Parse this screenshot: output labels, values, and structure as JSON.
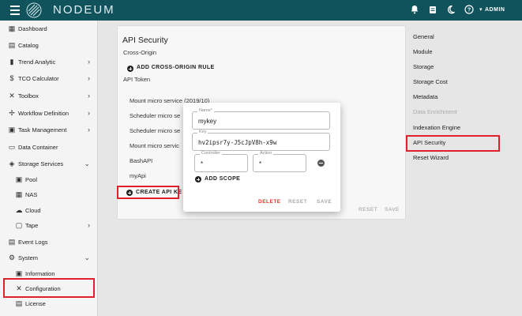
{
  "app": {
    "brand": "NODEUM",
    "user": "ADMIN",
    "notification_badge": "",
    "task_badge": ""
  },
  "sidebar": {
    "items": [
      {
        "label": "Dashboard",
        "icon": "dashboard-icon"
      },
      {
        "label": "Catalog",
        "icon": "catalog-icon"
      },
      {
        "label": "Trend Analytic",
        "icon": "bar-chart-icon",
        "expandable": true
      },
      {
        "label": "TCO Calculator",
        "icon": "dollar-icon",
        "expandable": true
      },
      {
        "label": "Toolbox",
        "icon": "tools-icon",
        "expandable": true
      },
      {
        "label": "Workflow Definition",
        "icon": "workflow-icon",
        "expandable": true
      },
      {
        "label": "Task Management",
        "icon": "calendar-icon",
        "expandable": true
      },
      {
        "label": "Data Container",
        "icon": "container-icon"
      },
      {
        "label": "Storage Services",
        "icon": "layers-icon",
        "expanded": true
      },
      {
        "label": "Pool",
        "icon": "pool-icon"
      },
      {
        "label": "NAS",
        "icon": "nas-icon"
      },
      {
        "label": "Cloud",
        "icon": "cloud-icon"
      },
      {
        "label": "Tape",
        "icon": "tape-icon",
        "expandable": true
      },
      {
        "label": "Event Logs",
        "icon": "event-log-icon"
      },
      {
        "label": "System",
        "icon": "gear-icon",
        "expanded": true
      },
      {
        "label": "Information",
        "icon": "info-card-icon"
      },
      {
        "label": "Configuration",
        "icon": "wrench-icon"
      },
      {
        "label": "License",
        "icon": "license-icon"
      }
    ]
  },
  "main": {
    "title": "API Security",
    "cross_origin_label": "Cross-Origin",
    "add_rule_label": "ADD CROSS-ORIGIN RULE",
    "api_token_label": "API Token",
    "tokens": [
      "Mount micro service (2019/10)",
      "Scheduler micro se",
      "Scheduler micro se",
      "Mount micro servic",
      "BashAPI",
      "myApi"
    ],
    "create_label": "CREATE API KE",
    "reset_label": "RESET",
    "save_label": "SAVE"
  },
  "right_menu": {
    "items": [
      {
        "label": "General",
        "disabled": false
      },
      {
        "label": "Module",
        "disabled": false
      },
      {
        "label": "Storage",
        "disabled": false
      },
      {
        "label": "Storage Cost",
        "disabled": false
      },
      {
        "label": "Metadata",
        "disabled": false
      },
      {
        "label": "Data Enrichment",
        "disabled": true
      },
      {
        "label": "Indexation Engine",
        "disabled": false
      },
      {
        "label": "API Security",
        "disabled": false,
        "selected": true
      },
      {
        "label": "Reset Wizard",
        "disabled": false
      }
    ]
  },
  "dialog": {
    "name_label": "Name*",
    "name_value": "mykey",
    "key_label": "Key",
    "key_value": "hv2ipsr7y-J5cJpV8h-x9w",
    "controller_label": "Controller",
    "controller_value": "*",
    "action_label": "Action",
    "action_value": "*",
    "add_scope_label": "ADD SCOPE",
    "delete_label": "DELETE",
    "reset_label": "RESET",
    "save_label": "SAVE"
  },
  "colors": {
    "header": "#10535c",
    "highlight": "#e0202a",
    "delete": "#e0352b"
  }
}
